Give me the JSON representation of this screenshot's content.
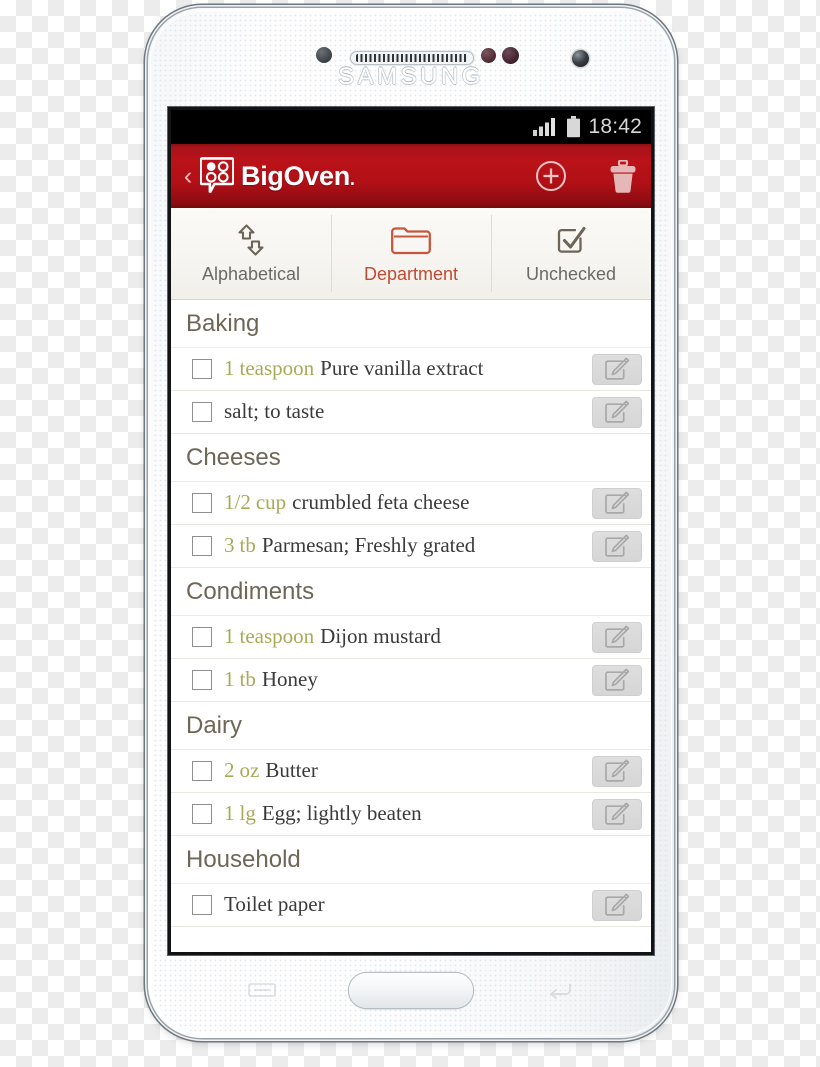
{
  "device": {
    "brand": "SAMSUNG",
    "hardware_keys": [
      "menu-key",
      "home-button",
      "back-key"
    ]
  },
  "status_bar": {
    "time": "18:42",
    "icons": [
      "signal-bars-icon",
      "battery-icon"
    ],
    "signal_bars_filled": 4,
    "signal_bars_total": 4,
    "background": "#000000"
  },
  "app_header": {
    "back_label": "‹",
    "brand_name": "BigOven",
    "brand_suffix": ".",
    "accent": "#b01016",
    "actions": [
      {
        "name": "add-item-button",
        "icon": "plus-circle-icon"
      },
      {
        "name": "delete-button",
        "icon": "trash-icon"
      }
    ]
  },
  "tabs": {
    "active_index": 1,
    "active_color": "#c24a33",
    "inactive_color": "#6a6a66",
    "items": [
      {
        "label": "Alphabetical",
        "icon": "sort-arrows-icon",
        "active": false
      },
      {
        "label": "Department",
        "icon": "folder-icon",
        "active": true
      },
      {
        "label": "Unchecked",
        "icon": "checkbox-checked-icon",
        "active": false
      }
    ]
  },
  "grocery_list": {
    "quantity_color": "#a5ab59",
    "item_color": "#3a3a3a",
    "header_color": "#6e6657",
    "sections": [
      {
        "title": "Baking",
        "items": [
          {
            "checked": false,
            "qty": "1",
            "unit": "teaspoon",
            "name": "Pure vanilla extract",
            "edit_icon": "pencil-square-icon"
          },
          {
            "checked": false,
            "qty": "",
            "unit": "",
            "name": "salt; to taste",
            "edit_icon": "pencil-square-icon"
          }
        ]
      },
      {
        "title": "Cheeses",
        "items": [
          {
            "checked": false,
            "qty": "1/2",
            "unit": "cup",
            "name": "crumbled feta cheese",
            "edit_icon": "pencil-square-icon"
          },
          {
            "checked": false,
            "qty": "3",
            "unit": "tb",
            "name": "Parmesan; Freshly grated",
            "edit_icon": "pencil-square-icon"
          }
        ]
      },
      {
        "title": "Condiments",
        "items": [
          {
            "checked": false,
            "qty": "1",
            "unit": "teaspoon",
            "name": "Dijon mustard",
            "edit_icon": "pencil-square-icon"
          },
          {
            "checked": false,
            "qty": "1",
            "unit": "tb",
            "name": "Honey",
            "edit_icon": "pencil-square-icon"
          }
        ]
      },
      {
        "title": "Dairy",
        "items": [
          {
            "checked": false,
            "qty": "2",
            "unit": "oz",
            "name": "Butter",
            "edit_icon": "pencil-square-icon"
          },
          {
            "checked": false,
            "qty": "1",
            "unit": "lg",
            "name": "Egg; lightly beaten",
            "edit_icon": "pencil-square-icon"
          }
        ]
      },
      {
        "title": "Household",
        "items": [
          {
            "checked": false,
            "qty": "",
            "unit": "",
            "name": "Toilet paper",
            "edit_icon": "pencil-square-icon"
          }
        ]
      }
    ]
  }
}
